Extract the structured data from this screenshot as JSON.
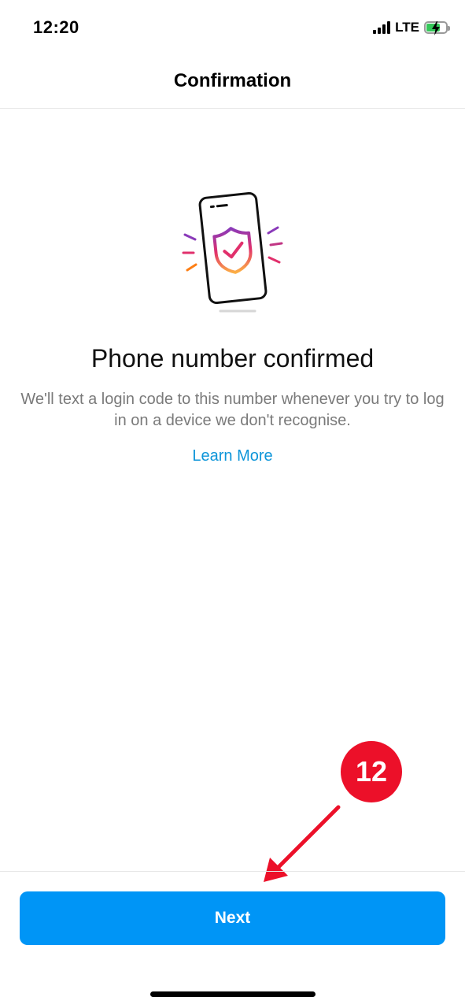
{
  "status_bar": {
    "time": "12:20",
    "network": "LTE",
    "battery_level": 0.75,
    "battery_charging": true,
    "signal_bars": 4
  },
  "header": {
    "title": "Confirmation"
  },
  "illustration": {
    "icon": "phone-shield-check-icon",
    "gradient_colors": [
      "#8a3ab9",
      "#e1306c",
      "#fd7e14",
      "#fcaf45"
    ]
  },
  "main": {
    "headline": "Phone number confirmed",
    "description": "We'll text a login code to this number whenever you try to log in on a device we don't recognise.",
    "learn_more_label": "Learn More"
  },
  "annotation": {
    "step_number": "12",
    "color": "#ec1029"
  },
  "footer": {
    "next_label": "Next",
    "button_color": "#0095f6"
  }
}
